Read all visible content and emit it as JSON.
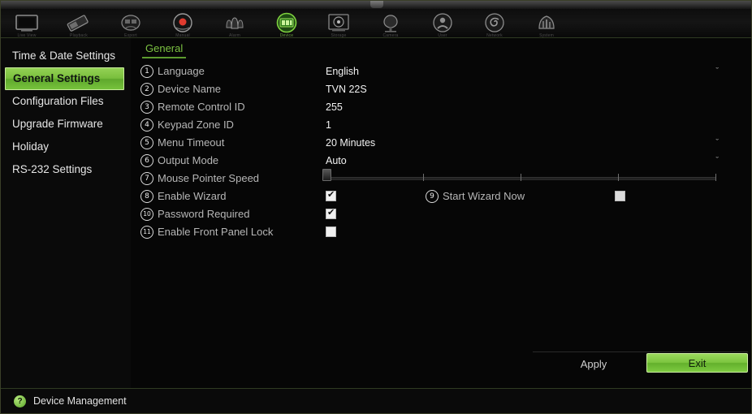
{
  "toolbar": {
    "items": [
      {
        "icon": "monitor-live-view-icon",
        "label": "Live View",
        "active": false
      },
      {
        "icon": "playback-icon",
        "label": "Playback",
        "active": false
      },
      {
        "icon": "export-archive-icon",
        "label": "Export",
        "active": false
      },
      {
        "icon": "record-manual-icon",
        "label": "Manual",
        "active": false
      },
      {
        "icon": "alarm-bells-icon",
        "label": "Alarm",
        "active": false
      },
      {
        "icon": "device-management-icon",
        "label": "Device",
        "active": true
      },
      {
        "icon": "storage-disk-icon",
        "label": "Storage",
        "active": false
      },
      {
        "icon": "camera-setup-icon",
        "label": "Camera",
        "active": false
      },
      {
        "icon": "user-management-icon",
        "label": "User",
        "active": false
      },
      {
        "icon": "network-settings-icon",
        "label": "Network",
        "active": false
      },
      {
        "icon": "system-info-icon",
        "label": "System",
        "active": false
      }
    ]
  },
  "sidebar": {
    "items": [
      {
        "label": "Time & Date Settings",
        "selected": false
      },
      {
        "label": "General Settings",
        "selected": true
      },
      {
        "label": "Configuration Files",
        "selected": false
      },
      {
        "label": "Upgrade Firmware",
        "selected": false
      },
      {
        "label": "Holiday",
        "selected": false
      },
      {
        "label": "RS-232 Settings",
        "selected": false
      }
    ]
  },
  "content": {
    "tab_label": "General",
    "rows": [
      {
        "num": "1",
        "label": "Language",
        "type": "select",
        "value": "English",
        "chevron": "ˇ"
      },
      {
        "num": "2",
        "label": "Device Name",
        "type": "text",
        "value": "TVN 22S",
        "chevron": ""
      },
      {
        "num": "3",
        "label": "Remote Control ID",
        "type": "text",
        "value": "255",
        "chevron": ""
      },
      {
        "num": "4",
        "label": "Keypad Zone ID",
        "type": "text",
        "value": "1",
        "chevron": ""
      },
      {
        "num": "5",
        "label": "Menu Timeout",
        "type": "select",
        "value": "20 Minutes",
        "chevron": "ˇ"
      },
      {
        "num": "6",
        "label": "Output Mode",
        "type": "select",
        "value": "Auto",
        "chevron": "ˇ"
      },
      {
        "num": "7",
        "label": "Mouse Pointer Speed",
        "type": "slider",
        "value": "",
        "chevron": ""
      },
      {
        "num": "8",
        "label": "Enable Wizard",
        "type": "checkbox",
        "value": "checked",
        "chevron": ""
      },
      {
        "num": "10",
        "label": "Password Required",
        "type": "checkbox",
        "value": "checked",
        "chevron": ""
      },
      {
        "num": "11",
        "label": "Enable Front Panel Lock",
        "type": "checkbox",
        "value": "unchecked",
        "chevron": ""
      }
    ],
    "start_wizard": {
      "num": "9",
      "label": "Start Wizard Now",
      "checked": "unchecked"
    },
    "slider": {
      "ticks": 4,
      "position_percent": 0
    }
  },
  "buttons": {
    "apply_label": "Apply",
    "exit_label": "Exit"
  },
  "statusbar": {
    "icon": "help-question-icon",
    "icon_glyph": "?",
    "text": "Device Management"
  },
  "colors": {
    "accent_green": "#7cc242",
    "highlight_green": "#79bf3d",
    "frame_border": "#3a3f28",
    "background": "#060606"
  }
}
